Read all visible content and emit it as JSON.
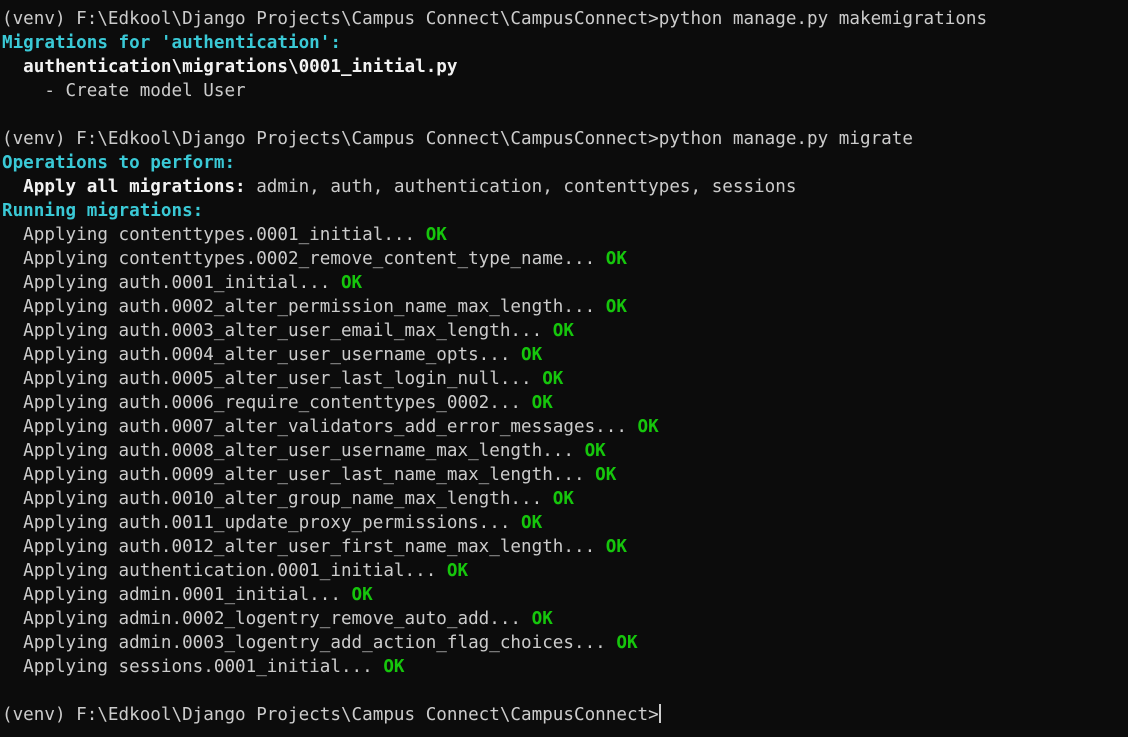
{
  "terminal": {
    "background_color": "#0c0c0c",
    "default_text_color": "#cccccc",
    "bold_text_color": "#f2f2f2",
    "cyan_color": "#3ac9d6",
    "green_color": "#16c60c",
    "prompt": "(venv) F:\\Edkool\\Django Projects\\Campus Connect\\CampusConnect>",
    "cursor_visible": true,
    "lines": [
      {
        "id": "line-prompt-makemigrations",
        "segments": [
          {
            "text": "(venv) F:\\Edkool\\Django Projects\\Campus Connect\\CampusConnect>",
            "style": "default"
          },
          {
            "text": "python manage.py makemigrations",
            "style": "default"
          }
        ]
      },
      {
        "id": "line-migrations-for",
        "segments": [
          {
            "text": "Migrations for 'authentication':",
            "style": "cyan"
          }
        ]
      },
      {
        "id": "line-migration-file",
        "segments": [
          {
            "text": "  authentication\\migrations\\0001_initial.py",
            "style": "white-bold"
          }
        ]
      },
      {
        "id": "line-create-model-user",
        "segments": [
          {
            "text": "    - Create model User",
            "style": "default"
          }
        ]
      },
      {
        "id": "line-blank-1",
        "segments": [
          {
            "text": "",
            "style": "default"
          }
        ]
      },
      {
        "id": "line-prompt-migrate",
        "segments": [
          {
            "text": "(venv) F:\\Edkool\\Django Projects\\Campus Connect\\CampusConnect>",
            "style": "default"
          },
          {
            "text": "python manage.py migrate",
            "style": "default"
          }
        ]
      },
      {
        "id": "line-operations-to-perform",
        "segments": [
          {
            "text": "Operations to perform:",
            "style": "cyan"
          }
        ]
      },
      {
        "id": "line-apply-all-migrations",
        "segments": [
          {
            "text": "  Apply all migrations:",
            "style": "white-bold"
          },
          {
            "text": " admin, auth, authentication, contenttypes, sessions",
            "style": "default"
          }
        ]
      },
      {
        "id": "line-running-migrations",
        "segments": [
          {
            "text": "Running migrations:",
            "style": "cyan"
          }
        ]
      },
      {
        "id": "line-apply-contenttypes-0001",
        "segments": [
          {
            "text": "  Applying contenttypes.0001_initial...",
            "style": "default"
          },
          {
            "text": " OK",
            "style": "green"
          }
        ]
      },
      {
        "id": "line-apply-contenttypes-0002",
        "segments": [
          {
            "text": "  Applying contenttypes.0002_remove_content_type_name...",
            "style": "default"
          },
          {
            "text": " OK",
            "style": "green"
          }
        ]
      },
      {
        "id": "line-apply-auth-0001",
        "segments": [
          {
            "text": "  Applying auth.0001_initial...",
            "style": "default"
          },
          {
            "text": " OK",
            "style": "green"
          }
        ]
      },
      {
        "id": "line-apply-auth-0002",
        "segments": [
          {
            "text": "  Applying auth.0002_alter_permission_name_max_length...",
            "style": "default"
          },
          {
            "text": " OK",
            "style": "green"
          }
        ]
      },
      {
        "id": "line-apply-auth-0003",
        "segments": [
          {
            "text": "  Applying auth.0003_alter_user_email_max_length...",
            "style": "default"
          },
          {
            "text": " OK",
            "style": "green"
          }
        ]
      },
      {
        "id": "line-apply-auth-0004",
        "segments": [
          {
            "text": "  Applying auth.0004_alter_user_username_opts...",
            "style": "default"
          },
          {
            "text": " OK",
            "style": "green"
          }
        ]
      },
      {
        "id": "line-apply-auth-0005",
        "segments": [
          {
            "text": "  Applying auth.0005_alter_user_last_login_null...",
            "style": "default"
          },
          {
            "text": " OK",
            "style": "green"
          }
        ]
      },
      {
        "id": "line-apply-auth-0006",
        "segments": [
          {
            "text": "  Applying auth.0006_require_contenttypes_0002...",
            "style": "default"
          },
          {
            "text": " OK",
            "style": "green"
          }
        ]
      },
      {
        "id": "line-apply-auth-0007",
        "segments": [
          {
            "text": "  Applying auth.0007_alter_validators_add_error_messages...",
            "style": "default"
          },
          {
            "text": " OK",
            "style": "green"
          }
        ]
      },
      {
        "id": "line-apply-auth-0008",
        "segments": [
          {
            "text": "  Applying auth.0008_alter_user_username_max_length...",
            "style": "default"
          },
          {
            "text": " OK",
            "style": "green"
          }
        ]
      },
      {
        "id": "line-apply-auth-0009",
        "segments": [
          {
            "text": "  Applying auth.0009_alter_user_last_name_max_length...",
            "style": "default"
          },
          {
            "text": " OK",
            "style": "green"
          }
        ]
      },
      {
        "id": "line-apply-auth-0010",
        "segments": [
          {
            "text": "  Applying auth.0010_alter_group_name_max_length...",
            "style": "default"
          },
          {
            "text": " OK",
            "style": "green"
          }
        ]
      },
      {
        "id": "line-apply-auth-0011",
        "segments": [
          {
            "text": "  Applying auth.0011_update_proxy_permissions...",
            "style": "default"
          },
          {
            "text": " OK",
            "style": "green"
          }
        ]
      },
      {
        "id": "line-apply-auth-0012",
        "segments": [
          {
            "text": "  Applying auth.0012_alter_user_first_name_max_length...",
            "style": "default"
          },
          {
            "text": " OK",
            "style": "green"
          }
        ]
      },
      {
        "id": "line-apply-authentication-0001",
        "segments": [
          {
            "text": "  Applying authentication.0001_initial...",
            "style": "default"
          },
          {
            "text": " OK",
            "style": "green"
          }
        ]
      },
      {
        "id": "line-apply-admin-0001",
        "segments": [
          {
            "text": "  Applying admin.0001_initial...",
            "style": "default"
          },
          {
            "text": " OK",
            "style": "green"
          }
        ]
      },
      {
        "id": "line-apply-admin-0002",
        "segments": [
          {
            "text": "  Applying admin.0002_logentry_remove_auto_add...",
            "style": "default"
          },
          {
            "text": " OK",
            "style": "green"
          }
        ]
      },
      {
        "id": "line-apply-admin-0003",
        "segments": [
          {
            "text": "  Applying admin.0003_logentry_add_action_flag_choices...",
            "style": "default"
          },
          {
            "text": " OK",
            "style": "green"
          }
        ]
      },
      {
        "id": "line-apply-sessions-0001",
        "segments": [
          {
            "text": "  Applying sessions.0001_initial...",
            "style": "default"
          },
          {
            "text": " OK",
            "style": "green"
          }
        ]
      },
      {
        "id": "line-blank-2",
        "segments": [
          {
            "text": "",
            "style": "default"
          }
        ]
      },
      {
        "id": "line-prompt-final",
        "segments": [
          {
            "text": "(venv) F:\\Edkool\\Django Projects\\Campus Connect\\CampusConnect>",
            "style": "default"
          }
        ],
        "cursor": true
      }
    ]
  }
}
